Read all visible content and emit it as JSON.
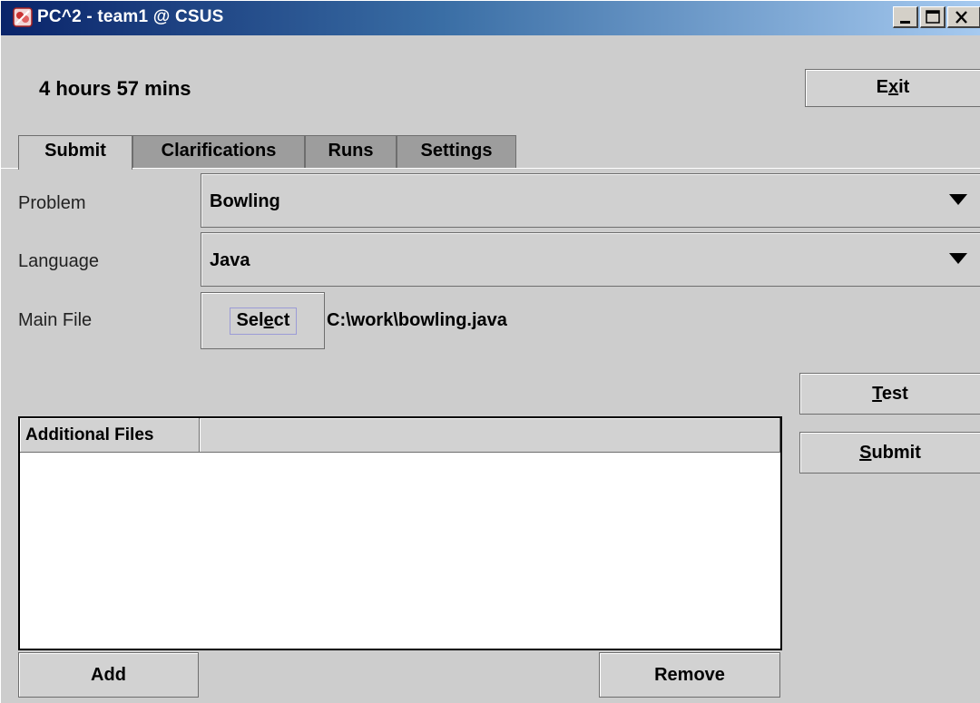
{
  "window": {
    "title": "PC^2 - team1 @ CSUS",
    "controls": [
      "minimize",
      "maximize",
      "close"
    ]
  },
  "header": {
    "time_remaining": "4 hours 57 mins",
    "exit_label": "Exit"
  },
  "tabs": [
    {
      "label": "Submit",
      "active": true
    },
    {
      "label": "Clarifications",
      "active": false
    },
    {
      "label": "Runs",
      "active": false
    },
    {
      "label": "Settings",
      "active": false
    }
  ],
  "form": {
    "problem_label": "Problem",
    "problem_value": "Bowling",
    "language_label": "Language",
    "language_value": "Java",
    "main_file_label": "Main File",
    "select_label": "Select",
    "main_file_path": "C:\\work\\bowling.java"
  },
  "actions": {
    "test_label": "Test",
    "submit_label": "Submit"
  },
  "additional_files": {
    "columns": [
      "Additional Files",
      ""
    ],
    "rows": [],
    "add_label": "Add",
    "remove_label": "Remove"
  },
  "colors": {
    "panel": "#cdcdcd",
    "titlebar_start": "#0a246a",
    "titlebar_end": "#a6caf0",
    "tab_inactive": "#9d9d9d"
  }
}
